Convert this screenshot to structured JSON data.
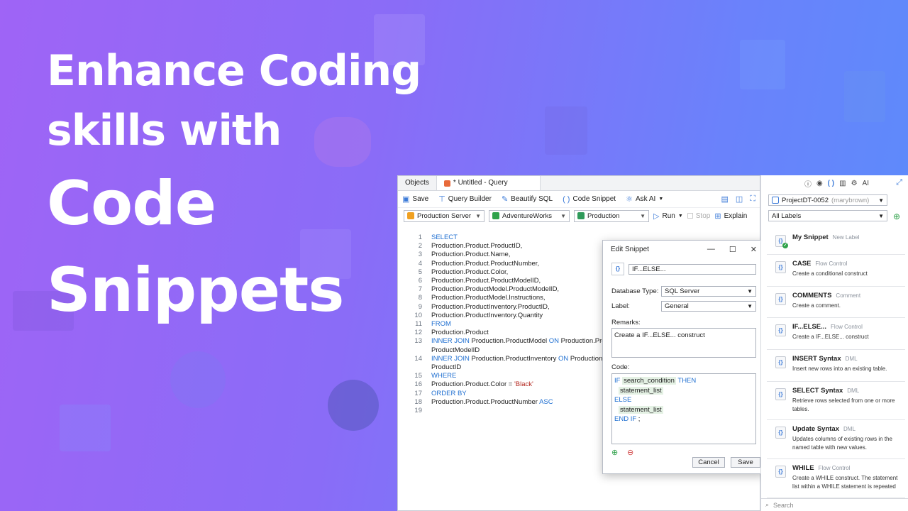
{
  "headline": {
    "line1": "Enhance Coding",
    "line2": "skills with",
    "line3": "Code",
    "line4": "Snippets"
  },
  "colors": {
    "accent": "#3b7ad8",
    "keyword": "#1f6fd1",
    "string": "#b3261e",
    "placeholder_bg": "#e4f1e4"
  },
  "tabs": {
    "objects": "Objects",
    "query": "* Untitled - Query"
  },
  "toolbar": {
    "save": "Save",
    "query_builder": "Query Builder",
    "beautify": "Beautify SQL",
    "code_snippet": "Code Snippet",
    "ask_ai": "Ask AI"
  },
  "toolbar2": {
    "server": "Production Server",
    "database": "AdventureWorks",
    "schema": "Production",
    "run": "Run",
    "stop": "Stop",
    "explain": "Explain"
  },
  "editor": {
    "lines": [
      {
        "n": "1",
        "pre": "",
        "kw": "SELECT",
        "post": "",
        "kw2": "",
        "post2": ""
      },
      {
        "n": "2",
        "pre": "Production.Product.ProductID,",
        "kw": "",
        "post": "",
        "kw2": "",
        "post2": ""
      },
      {
        "n": "3",
        "pre": "Production.Product.Name,",
        "kw": "",
        "post": "",
        "kw2": "",
        "post2": ""
      },
      {
        "n": "4",
        "pre": "Production.Product.ProductNumber,",
        "kw": "",
        "post": "",
        "kw2": "",
        "post2": ""
      },
      {
        "n": "5",
        "pre": "Production.Product.Color,",
        "kw": "",
        "post": "",
        "kw2": "",
        "post2": ""
      },
      {
        "n": "6",
        "pre": "Production.Product.ProductModelID,",
        "kw": "",
        "post": "",
        "kw2": "",
        "post2": ""
      },
      {
        "n": "7",
        "pre": "Production.ProductModel.ProductModelID,",
        "kw": "",
        "post": "",
        "kw2": "",
        "post2": ""
      },
      {
        "n": "8",
        "pre": "Production.ProductModel.Instructions,",
        "kw": "",
        "post": "",
        "kw2": "",
        "post2": ""
      },
      {
        "n": "9",
        "pre": "Production.ProductInventory.ProductID,",
        "kw": "",
        "post": "",
        "kw2": "",
        "post2": ""
      },
      {
        "n": "10",
        "pre": "Production.ProductInventory.Quantity",
        "kw": "",
        "post": "",
        "kw2": "",
        "post2": ""
      },
      {
        "n": "11",
        "pre": "",
        "kw": "FROM",
        "post": "",
        "kw2": "",
        "post2": ""
      },
      {
        "n": "12",
        "pre": "Production.Product",
        "kw": "",
        "post": "",
        "kw2": "",
        "post2": ""
      },
      {
        "n": "13",
        "pre": "",
        "kw": "INNER JOIN",
        "post": " Production.ProductModel ",
        "kw2": "ON",
        "post2": " Production.Pro"
      },
      {
        "n": "",
        "pre": "ProductModelID",
        "kw": "",
        "post": "",
        "kw2": "",
        "post2": ""
      },
      {
        "n": "14",
        "pre": "",
        "kw": "INNER JOIN",
        "post": " Production.ProductInventory ",
        "kw2": "ON",
        "post2": " Production."
      },
      {
        "n": "",
        "pre": "ProductID",
        "kw": "",
        "post": "",
        "kw2": "",
        "post2": ""
      },
      {
        "n": "15",
        "pre": "",
        "kw": "WHERE",
        "post": "",
        "kw2": "",
        "post2": ""
      },
      {
        "n": "16",
        "pre": "Production.Product.Color = ",
        "kw": "",
        "post": "",
        "kw2": "",
        "post2": "",
        "str": "'Black'"
      },
      {
        "n": "17",
        "pre": "",
        "kw": "ORDER BY",
        "post": "",
        "kw2": "",
        "post2": ""
      },
      {
        "n": "18",
        "pre": "Production.Product.ProductNumber ",
        "kw": "ASC",
        "post": "",
        "kw2": "",
        "post2": ""
      },
      {
        "n": "19",
        "pre": "",
        "kw": "",
        "post": "",
        "kw2": "",
        "post2": ""
      }
    ]
  },
  "dialog": {
    "title": "Edit Snippet",
    "name": "IF...ELSE...",
    "db_type_label": "Database Type:",
    "db_type_value": "SQL Server",
    "label_label": "Label:",
    "label_value": "General",
    "remarks_label": "Remarks:",
    "remarks_value": "Create a IF...ELSE... construct",
    "code_label": "Code:",
    "code": {
      "if": "IF",
      "cond": "search_condition",
      "then": "THEN",
      "stmt1": "statement_list",
      "else": "ELSE",
      "stmt2": "statement_list",
      "endif": "END IF",
      "semi": " ;"
    },
    "cancel": "Cancel",
    "save": "Save"
  },
  "panel": {
    "project": "ProjectDT-0052",
    "user": "(marybrown)",
    "labels": "All Labels",
    "search_placeholder": "Search",
    "items": [
      {
        "name": "My Snippet",
        "cat": "New Label",
        "desc": "",
        "custom": true
      },
      {
        "name": "CASE",
        "cat": "Flow Control",
        "desc": "Create a conditional construct"
      },
      {
        "name": "COMMENTS",
        "cat": "Comment",
        "desc": "Create a comment."
      },
      {
        "name": "IF...ELSE...",
        "cat": "Flow Control",
        "desc": "Create a IF...ELSE... construct"
      },
      {
        "name": "INSERT Syntax",
        "cat": "DML",
        "desc": "Insert new rows into an existing table."
      },
      {
        "name": "SELECT Syntax",
        "cat": "DML",
        "desc": "Retrieve rows selected from one or more tables."
      },
      {
        "name": "Update Syntax",
        "cat": "DML",
        "desc": "Updates columns of existing rows in the named table with new values."
      },
      {
        "name": "WHILE",
        "cat": "Flow Control",
        "desc": "Create a WHILE construct. The statement list within a WHILE statement is repeated"
      }
    ]
  }
}
